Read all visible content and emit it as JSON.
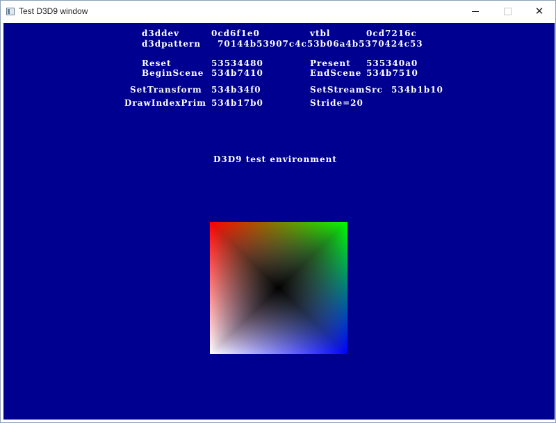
{
  "window": {
    "title": "Test D3D9 window",
    "icon": "application-window-icon",
    "controls": {
      "minimize": "minimize-icon",
      "maximize": "maximize-icon",
      "close": "close-icon"
    }
  },
  "overlay": {
    "background": "#000090",
    "text_color": "#ffffff",
    "d3ddev_label": "d3ddev",
    "d3ddev_value": "0cd6f1e0",
    "vtbl_label": "vtbl",
    "vtbl_value": "0cd7216c",
    "d3dpattern_label": "d3dpattern",
    "d3dpattern_value": "70144b53907c4c53b06a4b5370424c53",
    "reset_label": "Reset",
    "reset_value": "53534480",
    "present_label": "Present",
    "present_value": "535340a0",
    "beginscene_label": "BeginScene",
    "beginscene_value": "534b7410",
    "endscene_label": "EndScene",
    "endscene_value": "534b7510",
    "settransform_label": "SetTransform",
    "settransform_value": "534b34f0",
    "setstreamsrc_label": "SetStreamSrc",
    "setstreamsrc_value": "534b1b10",
    "drawindexprim_label": "DrawIndexPrim",
    "drawindexprim_value": "534b17b0",
    "stride_text": "Stride=20",
    "heading": "D3D9 test environment"
  },
  "quad": {
    "corner_colors": {
      "top_left": "#ff0000",
      "top_right": "#00ff00",
      "bottom_left": "#ffffff",
      "bottom_right": "#0000ff",
      "center": "#000000"
    }
  }
}
